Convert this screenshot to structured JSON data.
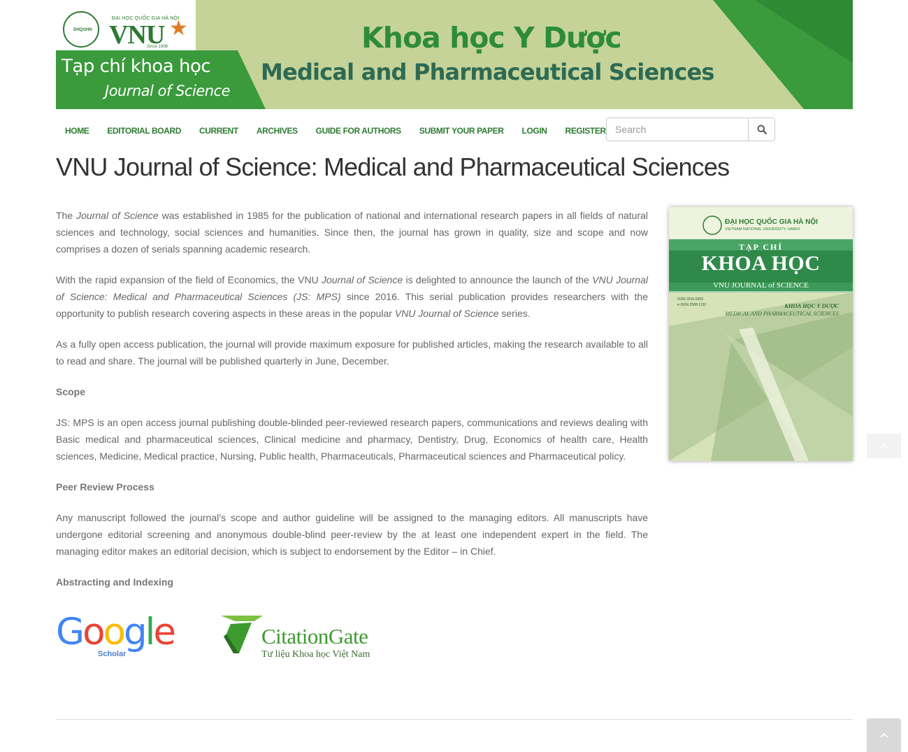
{
  "banner": {
    "vnu_small": "ĐẠI HỌC QUỐC GIA HÀ NỘI",
    "vnu_logo_text": "VNU",
    "vnu_since": "Since 1906",
    "vnu_badge": "DHQGHN",
    "title_vi": "Tạp chí khoa học",
    "title_en": "Journal of Science",
    "journal_vi": "Khoa học Y Dược",
    "journal_en": "Medical and Pharmaceutical Sciences",
    "colors": {
      "dark_green": "#3a9a3c",
      "light_green": "#c5d398",
      "text_green": "#2e8b3a"
    }
  },
  "nav": {
    "items": [
      "HOME",
      "EDITORIAL BOARD",
      "CURRENT",
      "ARCHIVES",
      "GUIDE FOR AUTHORS",
      "SUBMIT YOUR PAPER",
      "LOGIN",
      "REGISTER"
    ],
    "color": "#2e7d32"
  },
  "search": {
    "placeholder": "Search",
    "icon": "search-icon"
  },
  "page_title": "VNU Journal of Science: Medical and Pharmaceutical Sciences",
  "content": {
    "p1": {
      "a": "The ",
      "em1": "Journal of Science",
      "b": " was established in 1985 for the publication of national and international research papers in all fields of natural sciences and technology, social sciences and humanities. Since then, the journal has grown in quality, size and scope and now comprises a dozen of serials spanning academic research."
    },
    "p2": {
      "a": "With the rapid expansion of the field of Economics, the VNU ",
      "em1": "Journal of Science",
      "b": " is delighted to announce the launch of the ",
      "em2": "VNU Journal of Science: Medical and Pharmaceutical Sciences (JS: MPS)",
      "c": " since 2016. This serial publication provides researchers with the opportunity to publish research covering aspects in these areas in the popular ",
      "em3": "VNU Journal of Science",
      "d": " series."
    },
    "p3": "As a fully open access publication, the journal will provide maximum exposure for published articles, making the research available to all to read and share. The journal will be published quarterly in June, December.",
    "scope_heading": "Scope",
    "scope_text": "JS: MPS is an open access journal publishing double-blinded peer-reviewed research papers, communications and reviews dealing with Basic medical and pharmaceutical sciences, Clinical medicine and pharmacy, Dentistry, Drug, Economics of health care, Health sciences, Medicine, Medical practice, Nursing, Public health, Pharmaceuticals, Pharmaceutical sciences and Pharmaceutical policy.",
    "peer_heading": "Peer Review Process",
    "peer_text": "Any manuscript followed the journal’s scope and author guideline will be assigned to the managing editors. All manuscripts have undergone editorial screening and anonymous double-blind peer-review by the at least one independent expert in the field. The managing editor makes an editorial decision, which is subject to endorsement by the Editor – in Chief.",
    "indexing_heading": "Abstracting and Indexing"
  },
  "cover": {
    "university": "ĐẠI HỌC QUỐC GIA HÀ NỘI",
    "university_en": "VIETNAM NATIONAL UNIVERSITY, HANOI",
    "tap_chi": "TẠP CHÍ",
    "khoa_hoc": "KHOA HỌC",
    "vnu_jos": "VNU JOURNAL of SCIENCE",
    "issn1": "ISSN 2615-9309",
    "issn2": "e-ISSN 2588-1132",
    "sub_vi": "KHOA HỌC Y DƯỢC",
    "sub_en": "MEDICAL AND PHARMACEUTICAL SCIENCES"
  },
  "logos": {
    "google_letters": [
      "G",
      "o",
      "o",
      "g",
      "l",
      "e"
    ],
    "google_sub": "Scholar",
    "citationgate_name": "CitationGate",
    "citationgate_tagline": "Tư liệu Khoa học Việt Nam"
  },
  "controls": {
    "back_to_top_icon": "chevron-up-icon"
  }
}
